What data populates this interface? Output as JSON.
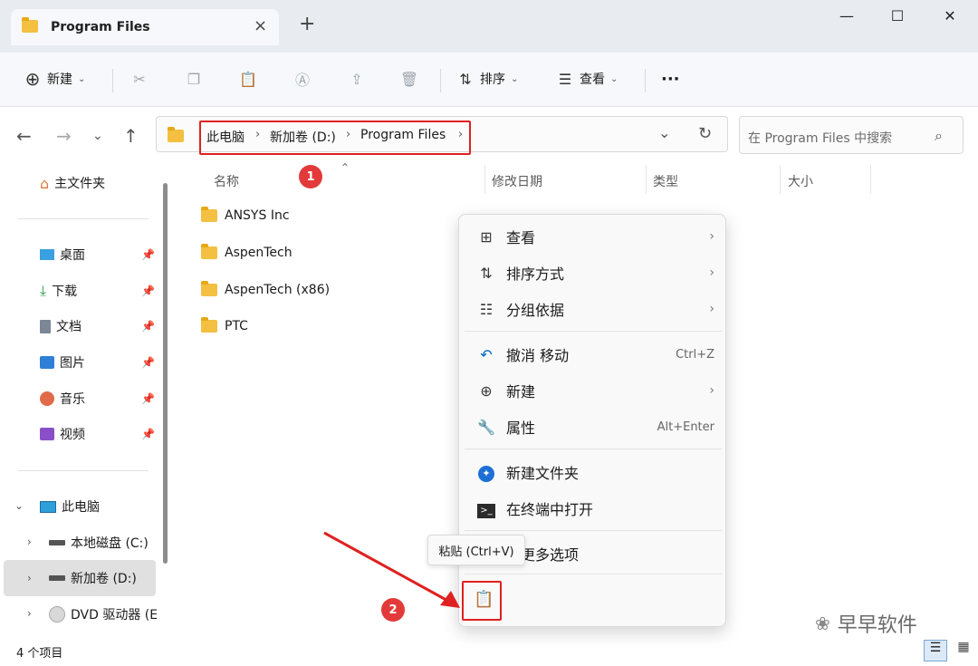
{
  "tab": {
    "title": "Program Files"
  },
  "toolbar": {
    "new_label": "新建",
    "sort_label": "排序",
    "view_label": "查看",
    "more_label": "···"
  },
  "address": {
    "crumbs": [
      "此电脑",
      "新加卷 (D:)",
      "Program Files"
    ],
    "search_placeholder": "在 Program Files 中搜索"
  },
  "sidebar": {
    "home": "主文件夹",
    "quick": [
      "桌面",
      "下载",
      "文档",
      "图片",
      "音乐",
      "视频"
    ],
    "this_pc": "此电脑",
    "drives": [
      "本地磁盘 (C:)",
      "新加卷 (D:)",
      "DVD 驱动器 (E"
    ]
  },
  "columns": {
    "name": "名称",
    "modified": "修改日期",
    "type": "类型",
    "size": "大小"
  },
  "files": [
    "ANSYS Inc",
    "AspenTech",
    "AspenTech (x86)",
    "PTC"
  ],
  "context_menu": {
    "view": "查看",
    "sort": "排序方式",
    "group": "分组依据",
    "undo": "撤消 移动",
    "undo_shortcut": "Ctrl+Z",
    "new": "新建",
    "properties": "属性",
    "properties_shortcut": "Alt+Enter",
    "new_folder": "新建文件夹",
    "terminal": "在终端中打开",
    "more": "示更多选项"
  },
  "tooltip": "粘贴 (Ctrl+V)",
  "badges": {
    "one": "1",
    "two": "2"
  },
  "status": {
    "count": "4 个项目"
  },
  "watermark": "早早软件",
  "colors": {
    "accent": "#0067c0",
    "highlight_red": "#e02020",
    "badge_red": "#e23a3a",
    "folder_yellow": "#f3c041"
  }
}
